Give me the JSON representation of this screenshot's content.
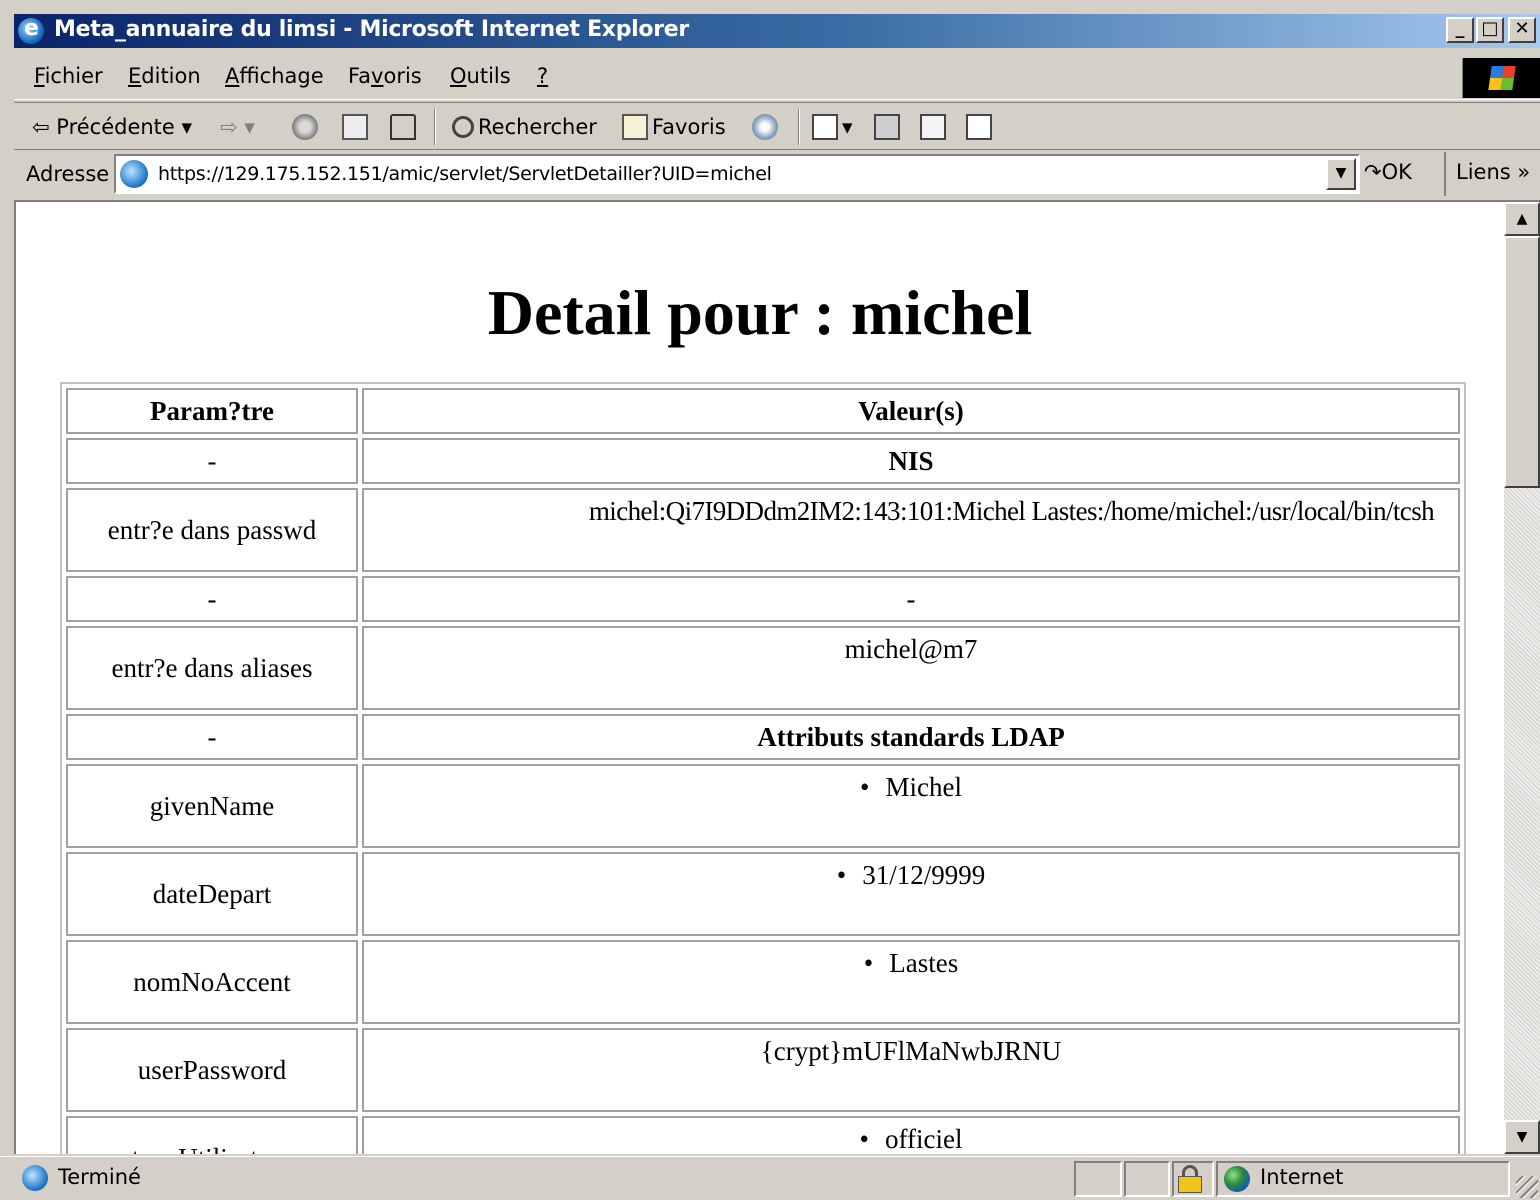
{
  "window": {
    "title": "Meta_annuaire du limsi - Microsoft Internet Explorer",
    "min_label": "_",
    "max_label": "□",
    "close_label": "✕"
  },
  "menu": {
    "items": [
      {
        "accel": "F",
        "rest": "ichier"
      },
      {
        "accel": "E",
        "rest": "dition"
      },
      {
        "accel": "A",
        "rest": "ffichage"
      },
      {
        "pre": "Fa",
        "accel": "v",
        "rest": "oris"
      },
      {
        "accel": "O",
        "rest": "utils"
      },
      {
        "accel": "?",
        "rest": ""
      }
    ]
  },
  "toolbar": {
    "back": "⇦ Précédente ▾",
    "forward": "⇨ ▾",
    "search": "Rechercher",
    "favorites": "Favoris"
  },
  "address": {
    "label": "Adresse",
    "url": "https://129.175.152.151/amic/servlet/ServletDetailler?UID=michel",
    "go": "OK",
    "links": "Liens »"
  },
  "page": {
    "title": "Detail pour : michel",
    "table": {
      "headers": [
        "Param?tre",
        "Valeur(s)"
      ],
      "rows": [
        {
          "param": "-",
          "value": "NIS",
          "value_bold": true
        },
        {
          "param": "entr?e dans passwd",
          "value": "michel:Qi7I9DDdm2IM2:143:101:Michel Lastes:/home/michel:/usr/local/bin/tcsh"
        },
        {
          "param": "-",
          "value": "-"
        },
        {
          "param": "entr?e dans aliases",
          "value": "michel@m7"
        },
        {
          "param": "-",
          "value": "Attributs standards LDAP",
          "value_bold": true
        },
        {
          "param": "givenName",
          "value": "Michel",
          "bullet": true
        },
        {
          "param": "dateDepart",
          "value": "31/12/9999",
          "bullet": true
        },
        {
          "param": "nomNoAccent",
          "value": "Lastes",
          "bullet": true
        },
        {
          "param": "userPassword",
          "value": "{crypt}mUFlMaNwbJRNU"
        },
        {
          "param": "typeUtilisateur",
          "value": "officiel",
          "bullet": true
        }
      ]
    }
  },
  "status": {
    "text": "Terminé",
    "zone": "Internet"
  },
  "colors": {
    "titlebar_start": "#0a246a",
    "titlebar_end": "#a6caf0",
    "chrome": "#d4d0c8"
  }
}
